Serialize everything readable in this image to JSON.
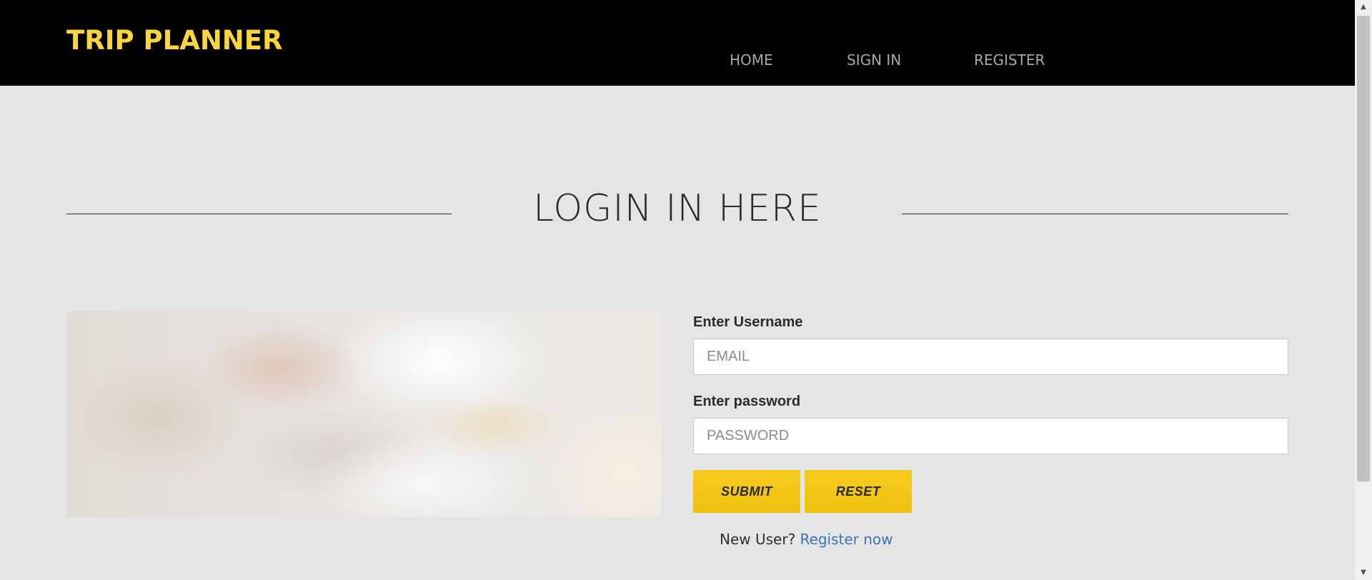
{
  "header": {
    "brand": "TRIP PLANNER",
    "nav": {
      "home": "HOME",
      "sign_in": "SIGN IN",
      "register": "REGISTER"
    }
  },
  "main": {
    "title": "LOGIN IN HERE",
    "form": {
      "username_label": "Enter Username",
      "username_placeholder": "EMAIL",
      "password_label": "Enter password",
      "password_placeholder": "PASSWORD",
      "submit_label": "SUBMIT",
      "reset_label": "RESET",
      "new_user_text": "New User?",
      "register_link": "Register now"
    }
  },
  "scrollbar": {
    "up_icon": "scroll-up-arrow-icon",
    "down_icon": "scroll-down-arrow-icon"
  },
  "colors": {
    "navbar_bg": "#000000",
    "brand": "#fcd43b",
    "nav_link": "#a8a8a8",
    "page_bg": "#e5e5e5",
    "button": "#f5c518",
    "link": "#3a74b4"
  }
}
